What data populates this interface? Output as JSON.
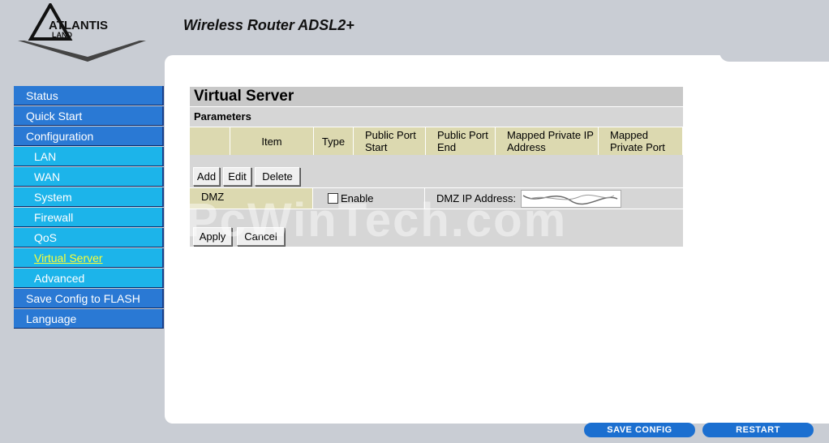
{
  "brand": {
    "logo_text": "ATLANTIS",
    "logo_subtext": "LAND",
    "product_title": "Wireless Router ADSL2+"
  },
  "sidebar": {
    "items": [
      {
        "label": "Status",
        "level": "top"
      },
      {
        "label": "Quick Start",
        "level": "top"
      },
      {
        "label": "Configuration",
        "level": "top"
      },
      {
        "label": "LAN",
        "level": "sub"
      },
      {
        "label": "WAN",
        "level": "sub"
      },
      {
        "label": "System",
        "level": "sub"
      },
      {
        "label": "Firewall",
        "level": "sub"
      },
      {
        "label": "QoS",
        "level": "sub"
      },
      {
        "label": "Virtual Server",
        "level": "sub",
        "active": true
      },
      {
        "label": "Advanced",
        "level": "sub"
      },
      {
        "label": "Save Config to FLASH",
        "level": "top"
      },
      {
        "label": "Language",
        "level": "top"
      }
    ]
  },
  "main": {
    "title": "Virtual Server",
    "section": "Parameters",
    "columns": [
      "Item",
      "Type",
      "Public Port Start",
      "Public Port End",
      "Mapped Private IP Address",
      "Mapped Private Port"
    ],
    "buttons": {
      "add": "Add",
      "edit": "Edit",
      "delete": "Delete",
      "apply": "Apply",
      "cancel": "Cancel"
    },
    "dmz": {
      "label": "DMZ",
      "enable_label": "Enable",
      "enabled": false,
      "ip_label": "DMZ IP Address:"
    }
  },
  "watermark": "PcWinTech.com",
  "footer": {
    "save_config": "SAVE CONFIG",
    "restart": "RESTART"
  },
  "colors": {
    "nav_top": "#2a79d4",
    "nav_sub": "#1cb4ea",
    "active_text": "#ffff33",
    "header_bg": "#dcd9b0",
    "button_blue": "#1b6fd0"
  }
}
